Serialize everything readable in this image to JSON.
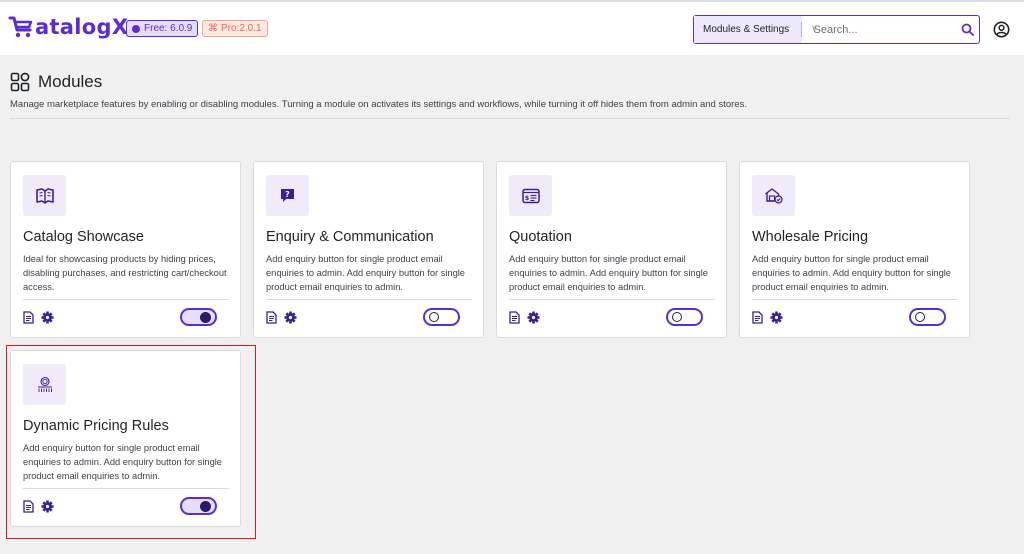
{
  "header": {
    "logo_text": "atalogX",
    "free_badge": "Free: 6.0.9",
    "pro_badge": "Pro:2.0.1",
    "search_scope": "Modules & Settings",
    "search_placeholder": "Search..."
  },
  "page": {
    "title": "Modules",
    "description": "Manage marketplace features by enabling or disabling modules. Turning a module on activates its settings and workflows, while turning it off hides them from admin and stores."
  },
  "modules": [
    {
      "icon": "catalog-book-icon",
      "title": "Catalog Showcase",
      "description": "Ideal for showcasing products by hiding prices, disabling purchases, and restricting cart/checkout access.",
      "enabled": true
    },
    {
      "icon": "enquiry-chat-icon",
      "title": "Enquiry & Communication",
      "description": "Add enquiry button for single product email enquiries to admin. Add enquiry button for single product email enquiries to admin.",
      "enabled": false
    },
    {
      "icon": "quotation-invoice-icon",
      "title": "Quotation",
      "description": "Add enquiry button for single product email enquiries to admin. Add enquiry button for single product email enquiries to admin.",
      "enabled": false
    },
    {
      "icon": "wholesale-house-icon",
      "title": "Wholesale Pricing",
      "description": "Add enquiry button for single product email enquiries to admin. Add enquiry button for single product email enquiries to admin.",
      "enabled": false
    },
    {
      "icon": "dynamic-pricing-icon",
      "title": "Dynamic Pricing Rules",
      "description": "Add enquiry button for single product email enquiries to admin. Add enquiry button for single product email enquiries to admin.",
      "enabled": true
    }
  ],
  "colors": {
    "accent": "#5b2bd6",
    "toggle_on_knob": "#2b1a66",
    "highlight_border": "#e0191f",
    "page_background": "#f0f0f1"
  }
}
